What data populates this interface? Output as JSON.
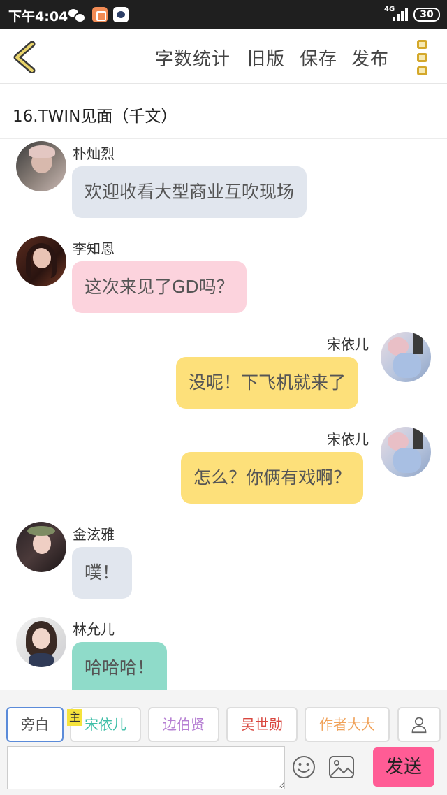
{
  "status_bar": {
    "time": "下午4:04",
    "network": "4G",
    "battery": "30",
    "icons": [
      "wechat-icon",
      "app-icon",
      "app-icon"
    ]
  },
  "toolbar": {
    "back_icon": "chevron-left-icon",
    "word_count_label": "字数统计",
    "old_version_label": "旧版",
    "save_label": "保存",
    "publish_label": "发布",
    "menu_icon": "more-vertical-icon",
    "accent_color": "#d4a82a"
  },
  "chapter": {
    "title": "16.TWIN见面（千文）"
  },
  "messages": [
    {
      "side": "left",
      "name": "朴灿烈",
      "text": "欢迎收看大型商业互吹现场",
      "color": "#e1e6ee"
    },
    {
      "side": "left",
      "name": "李知恩",
      "text": "这次来见了GD吗？",
      "color": "#fcd3dd"
    },
    {
      "side": "right",
      "name": "宋依儿",
      "text": "没呢！下飞机就来了",
      "color": "#fde07a"
    },
    {
      "side": "right",
      "name": "宋依儿",
      "text": "怎么？你俩有戏啊？",
      "color": "#fde07a"
    },
    {
      "side": "left",
      "name": "金泫雅",
      "text": "噗！",
      "color": "#e1e6ee"
    },
    {
      "side": "left",
      "name": "林允儿",
      "text": "哈哈哈！",
      "color": "#8fdbc9"
    }
  ],
  "characters": {
    "narrator": {
      "label": "旁白",
      "color": "#5b8bd9"
    },
    "host_tag": "主",
    "items": [
      {
        "label": "宋依儿",
        "color": "#3fbfa8"
      },
      {
        "label": "边伯贤",
        "color": "#b67fd3"
      },
      {
        "label": "吴世勋",
        "color": "#d9473f"
      },
      {
        "label": "作者大大",
        "color": "#f0a25a"
      }
    ],
    "add_icon": "user-icon"
  },
  "input_bar": {
    "placeholder": "",
    "emoji_icon": "smiley-icon",
    "image_icon": "image-icon",
    "send_label": "发送",
    "send_color": "#ff5c95"
  }
}
